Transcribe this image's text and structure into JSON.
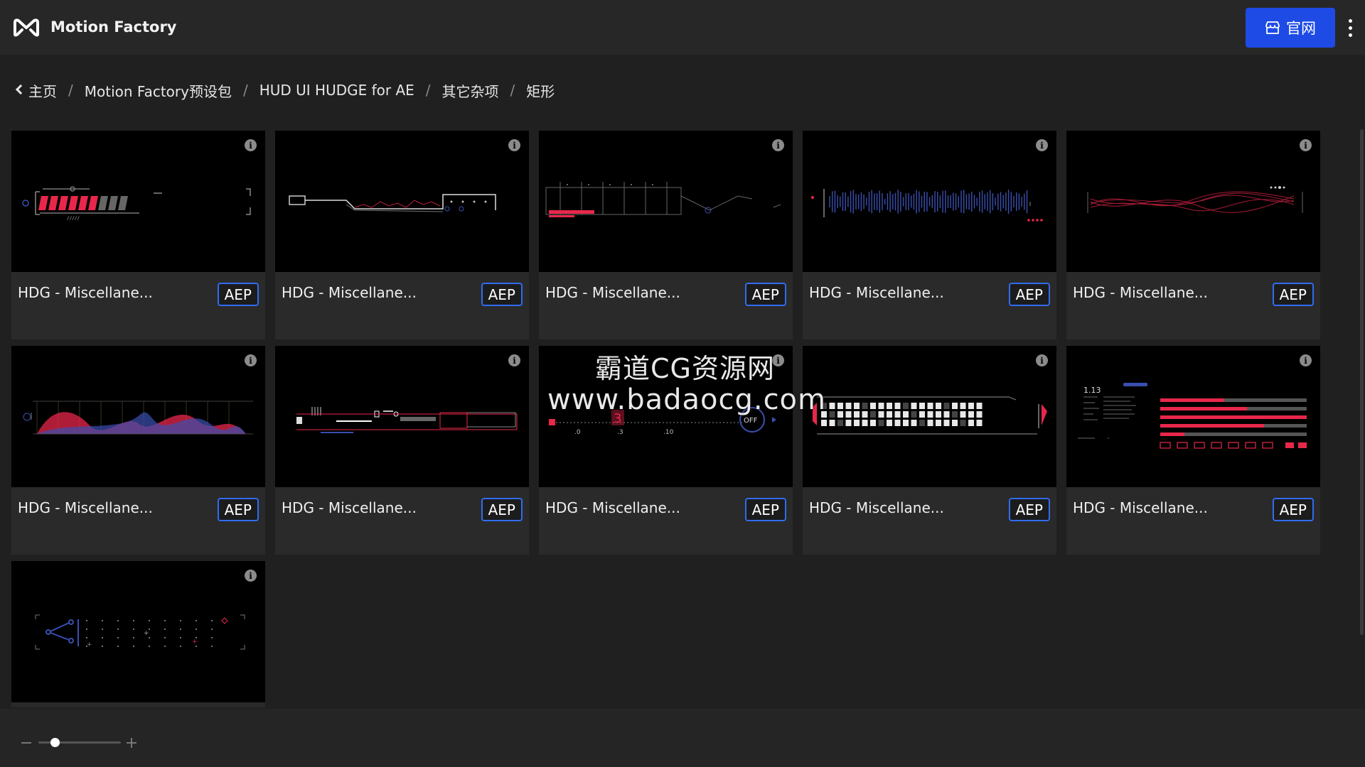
{
  "header": {
    "app_title": "Motion Factory",
    "site_button_label": "官网",
    "logo_icon": "motion-factory-logo-icon",
    "store_icon": "storefront-icon",
    "menu_icon": "kebab-menu-icon"
  },
  "breadcrumb": {
    "items": [
      "主页",
      "Motion Factory预设包",
      "HUD UI HUDGE for AE",
      "其它杂项",
      "矩形"
    ],
    "separator": "/"
  },
  "cards": [
    {
      "title": "HDG - Miscellane...",
      "badge": "AEP",
      "info": "i"
    },
    {
      "title": "HDG - Miscellane...",
      "badge": "AEP",
      "info": "i"
    },
    {
      "title": "HDG - Miscellane...",
      "badge": "AEP",
      "info": "i"
    },
    {
      "title": "HDG - Miscellane...",
      "badge": "AEP",
      "info": "i"
    },
    {
      "title": "HDG - Miscellane...",
      "badge": "AEP",
      "info": "i"
    },
    {
      "title": "HDG - Miscellane...",
      "badge": "AEP",
      "info": "i"
    },
    {
      "title": "HDG - Miscellane...",
      "badge": "AEP",
      "info": "i"
    },
    {
      "title": "HDG - Miscellane...",
      "badge": "AEP",
      "info": "i"
    },
    {
      "title": "HDG - Miscellane...",
      "badge": "AEP",
      "info": "i"
    },
    {
      "title": "HDG - Miscellane...",
      "badge": "AEP",
      "info": "i"
    },
    {
      "title": "",
      "badge": "",
      "info": "i"
    }
  ],
  "watermark": {
    "line1": "霸道CG资源网",
    "line2": "www.badaocg.com"
  },
  "thumb_labels": {
    "t8_number": "3",
    "t8_off": "OFF",
    "t8_tick0": ".0",
    "t8_tick1": ".3",
    "t8_tick2": ".10",
    "t10_value": "1.13"
  },
  "zoom": {
    "level": 0.2
  },
  "colors": {
    "accent": "#1e4be6",
    "badge_border": "#2f6cf0",
    "hud_red": "#e8274b",
    "hud_blue": "#3a4fb0"
  }
}
